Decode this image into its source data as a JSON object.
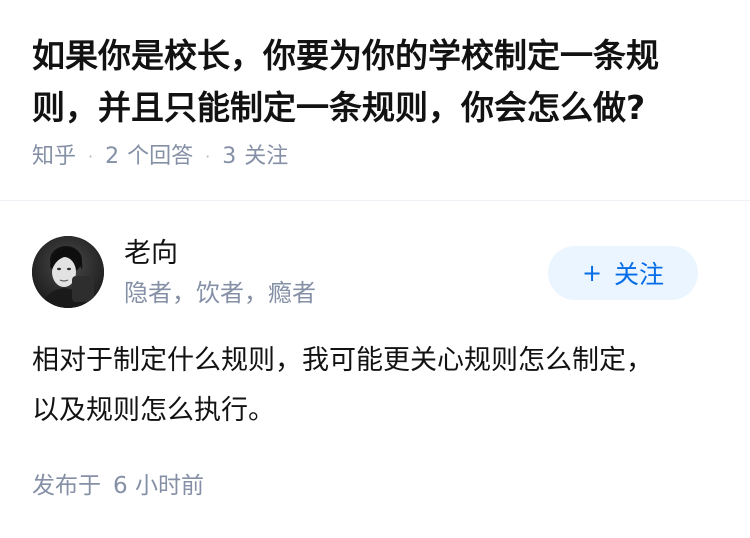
{
  "question": {
    "title": "如果你是校长，你要为你的学校制定一条规则，并且只能制定一条规则，你会怎么做?",
    "source": "知乎",
    "answer_count": "2",
    "answer_label": "个回答",
    "follower_count": "3",
    "follower_label": "关注",
    "separator": "·"
  },
  "author": {
    "name": "老向",
    "bio": "隐者，饮者，瘾者",
    "avatar_icon": "user-avatar",
    "follow_button": {
      "plus": "+",
      "label": "关注"
    }
  },
  "answer": {
    "content": "相对于制定什么规则，我可能更关心规则怎么制定，以及规则怎么执行。",
    "published_prefix": "发布于",
    "published_time": "6 小时前"
  },
  "colors": {
    "accent": "#056de8",
    "accent_bg": "#ebf5ff",
    "meta_gray": "#8590a6",
    "text": "#121212"
  }
}
